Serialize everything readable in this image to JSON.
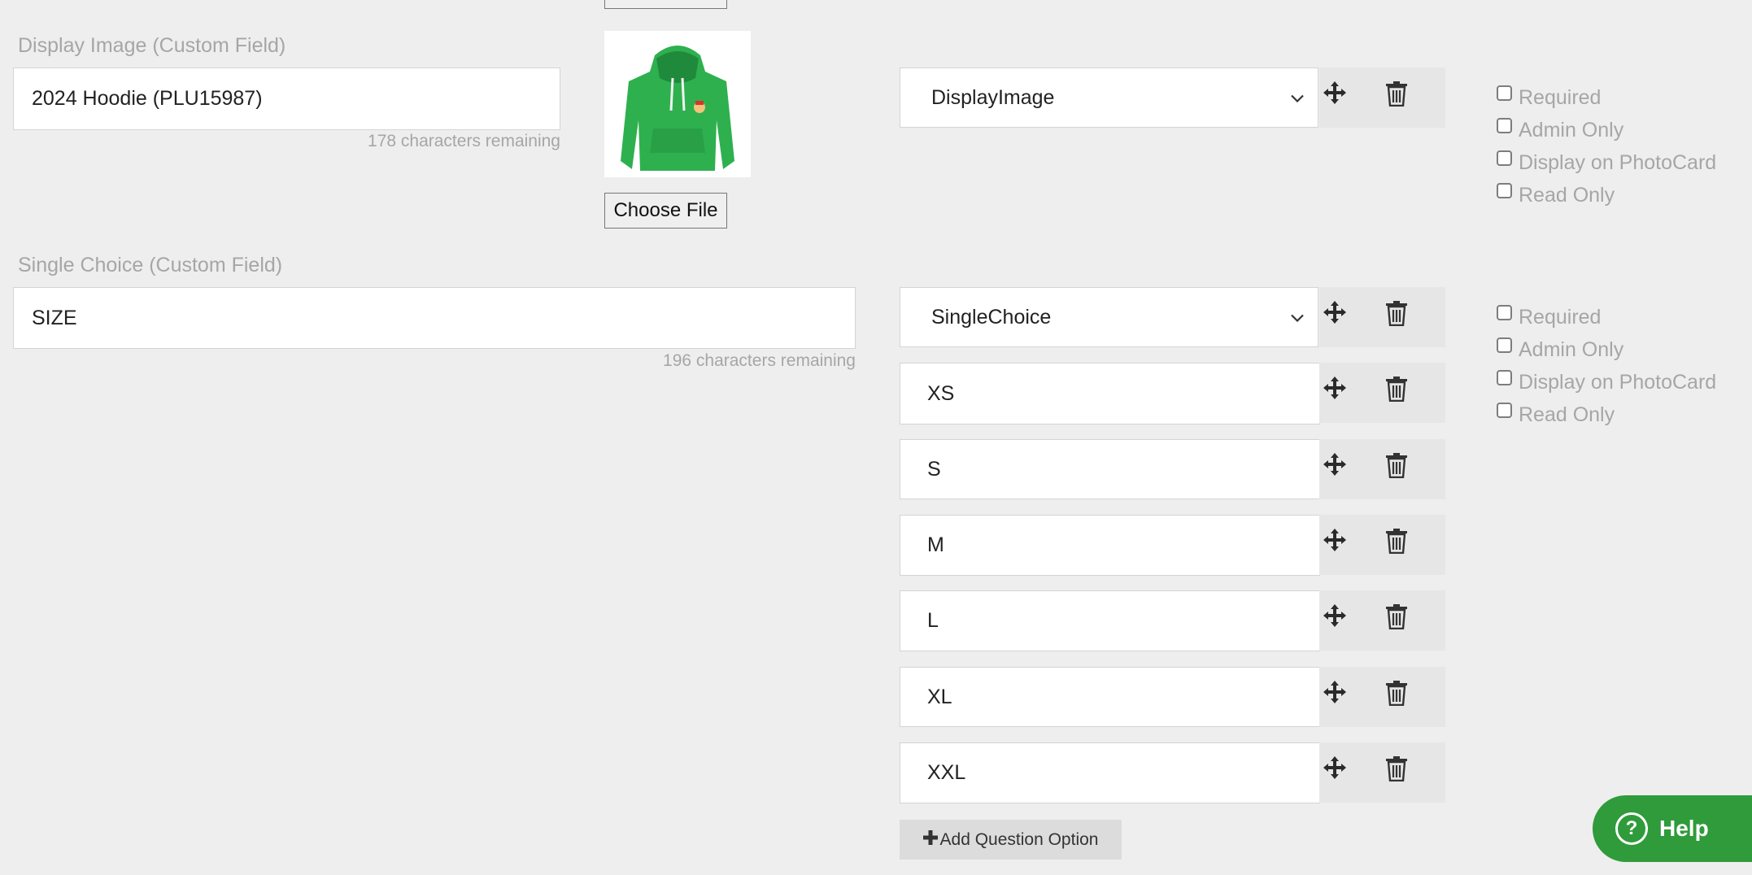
{
  "display_image": {
    "label": "Display Image (Custom Field)",
    "value": "2024 Hoodie (PLU15987)",
    "remaining": "178 characters remaining",
    "choose_file": "Choose File",
    "type": "DisplayImage"
  },
  "single_choice": {
    "label": "Single Choice (Custom Field)",
    "value": "SIZE",
    "remaining": "196 characters remaining",
    "type": "SingleChoice",
    "options": [
      "XS",
      "S",
      "M",
      "L",
      "XL",
      "XXL"
    ],
    "add_option": "Add Question Option"
  },
  "checkbox_labels": [
    "Required",
    "Admin Only",
    "Display on PhotoCard",
    "Read Only"
  ],
  "help": {
    "label": "Help"
  },
  "icons": {
    "move": "move-arrows-icon",
    "delete": "trash-icon",
    "plus": "plus-icon",
    "help": "question-circle-icon",
    "chevron": "chevron-down-icon"
  },
  "colors": {
    "help_green": "#2f9b3a",
    "background": "#eeeeee"
  }
}
